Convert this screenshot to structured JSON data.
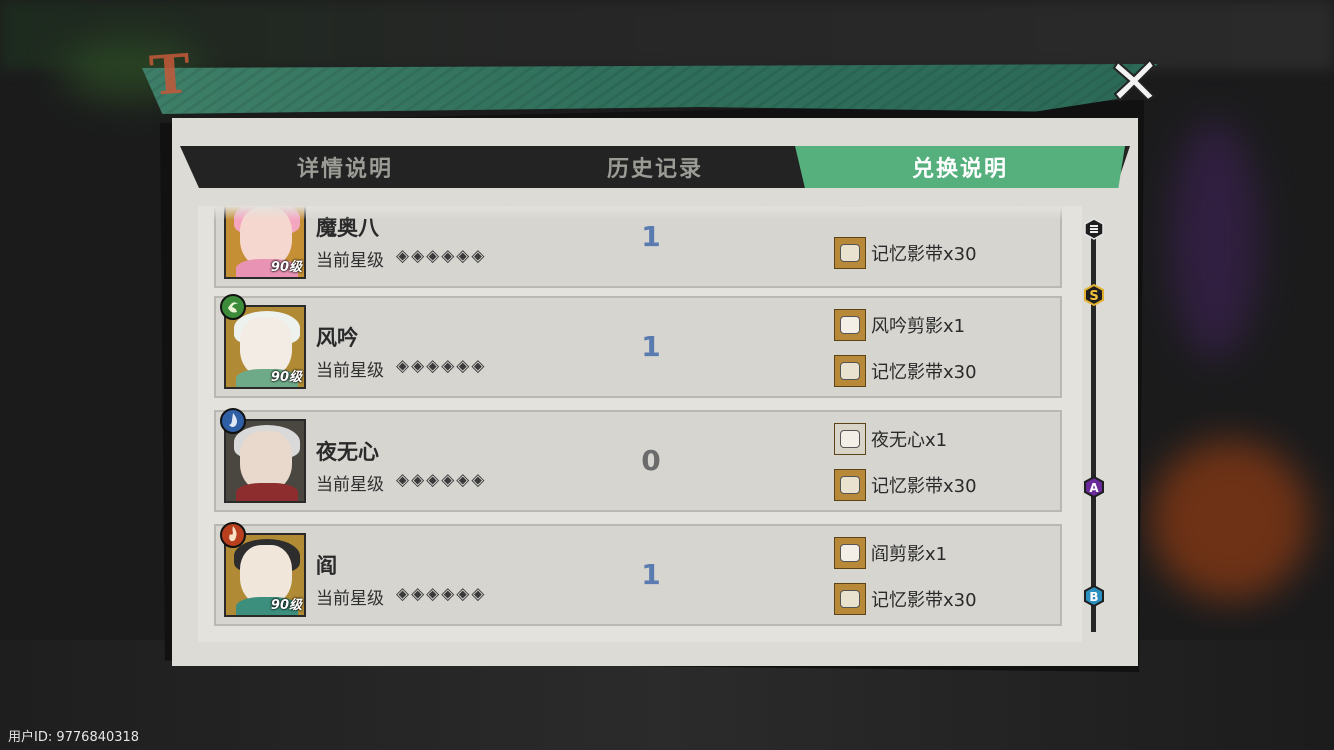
{
  "tabs": [
    {
      "label": "详情说明",
      "active": false
    },
    {
      "label": "历史记录",
      "active": false
    },
    {
      "label": "兑换说明",
      "active": true
    }
  ],
  "rows": [
    {
      "name": "魔奥八",
      "level": "90级",
      "star_label": "当前星级",
      "stars": "◈◈◈◈◈◈",
      "count": "1",
      "count_color": "#5a7bb0",
      "rewards": [
        "",
        "记忆影带x30"
      ]
    },
    {
      "name": "风吟",
      "level": "90级",
      "element_icon": "wind-element-icon",
      "star_label": "当前星级",
      "stars": "◈◈◈◈◈◈",
      "count": "1",
      "count_color": "#5a7bb0",
      "rewards": [
        "风吟剪影x1",
        "记忆影带x30"
      ]
    },
    {
      "name": "夜无心",
      "level": "",
      "element_icon": "water-element-icon",
      "star_label": "当前星级",
      "stars": "◈◈◈◈◈◈",
      "count": "0",
      "count_color": "#6b6b6b",
      "rewards": [
        "夜无心x1",
        "记忆影带x30"
      ]
    },
    {
      "name": "阎",
      "level": "90级",
      "element_icon": "fire-element-icon",
      "star_label": "当前星级",
      "stars": "◈◈◈◈◈◈",
      "count": "1",
      "count_color": "#5a7bb0",
      "rewards": [
        "阎剪影x1",
        "记忆影带x30"
      ]
    }
  ],
  "tier_markers": [
    "S",
    "A",
    "B"
  ],
  "user_id": "用户ID: 9776840318",
  "colors": {
    "accent_green": "#55b07e",
    "header_green": "#2f6f5b",
    "panel_bg": "#dcdbd6",
    "count_blue": "#5a7bb0"
  }
}
